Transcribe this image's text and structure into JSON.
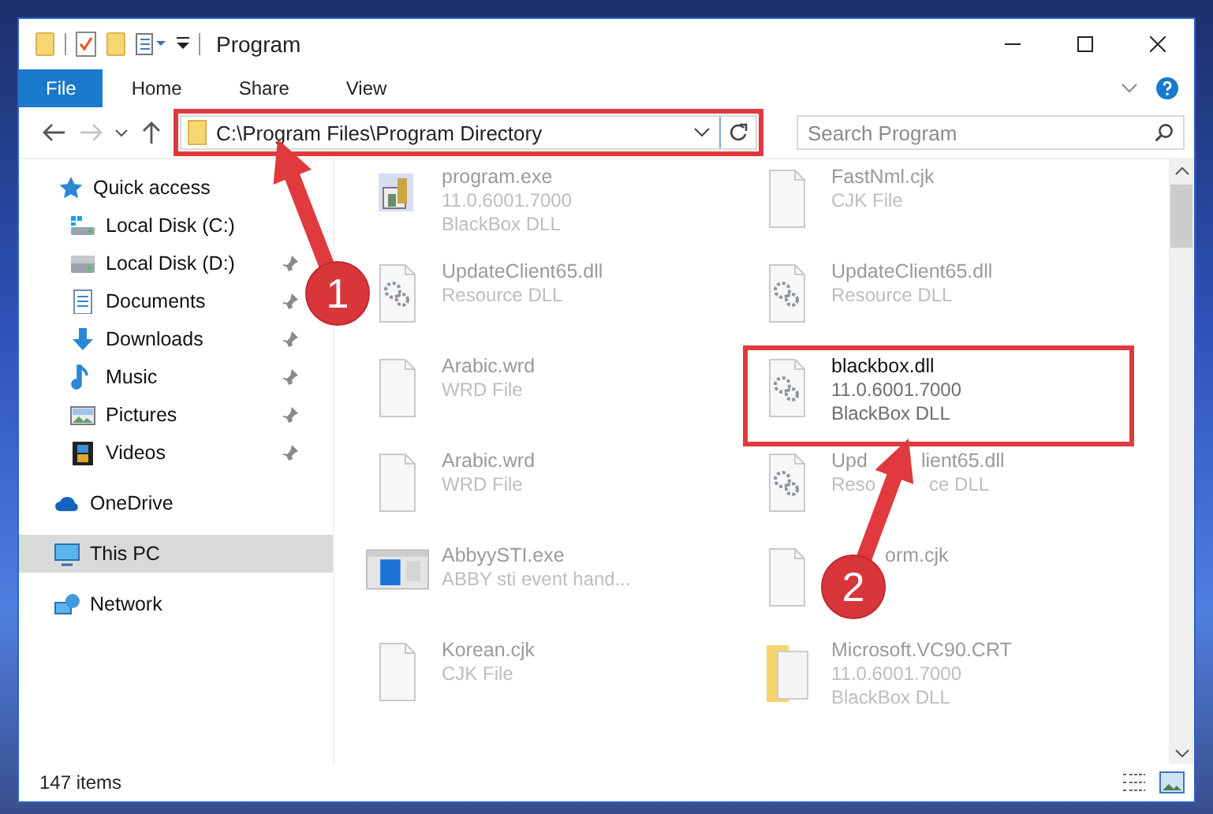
{
  "window": {
    "title": "Program"
  },
  "ribbon_tabs": [
    {
      "label": "File",
      "selected": true
    },
    {
      "label": "Home",
      "selected": false
    },
    {
      "label": "Share",
      "selected": false
    },
    {
      "label": "View",
      "selected": false
    }
  ],
  "address_bar": {
    "path": "C:\\Program Files\\Program Directory",
    "highlighted": true
  },
  "search": {
    "placeholder": "Search Program"
  },
  "sidebar": {
    "items": [
      {
        "label": "Quick access",
        "kind": "quick",
        "selected": false,
        "pinned": false,
        "children": [
          {
            "label": "Local Disk (C:)",
            "kind": "diskc",
            "selected": false,
            "pinned": false
          },
          {
            "label": "Local Disk (D:)",
            "kind": "disk",
            "selected": false,
            "pinned": true
          },
          {
            "label": "Documents",
            "kind": "docs",
            "selected": false,
            "pinned": true
          },
          {
            "label": "Downloads",
            "kind": "down",
            "selected": false,
            "pinned": true
          },
          {
            "label": "Music",
            "kind": "music",
            "selected": false,
            "pinned": true
          },
          {
            "label": "Pictures",
            "kind": "pics",
            "selected": false,
            "pinned": true
          },
          {
            "label": "Videos",
            "kind": "video",
            "selected": false,
            "pinned": true
          }
        ]
      },
      {
        "label": "OneDrive",
        "kind": "cloud",
        "selected": false,
        "pinned": false
      },
      {
        "label": "This PC",
        "kind": "pc",
        "selected": true,
        "pinned": false
      },
      {
        "label": "Network",
        "kind": "net",
        "selected": false,
        "pinned": false
      }
    ]
  },
  "files": [
    {
      "name": "program.exe",
      "details": [
        "11.0.6001.7000",
        "BlackBox DLL"
      ],
      "kind": "exe",
      "highlighted": false
    },
    {
      "name": "FastNml.cjk",
      "details": [
        "CJK File"
      ],
      "kind": "file",
      "highlighted": false
    },
    {
      "name": "UpdateClient65.dll",
      "details": [
        "Resource DLL"
      ],
      "kind": "gear",
      "highlighted": false
    },
    {
      "name": "UpdateClient65.dll",
      "details": [
        "Resource DLL"
      ],
      "kind": "gear",
      "highlighted": false
    },
    {
      "name": "Arabic.wrd",
      "details": [
        "WRD File"
      ],
      "kind": "file",
      "highlighted": false
    },
    {
      "name": "blackbox.dll",
      "details": [
        "11.0.6001.7000",
        "BlackBox DLL"
      ],
      "kind": "gear",
      "highlighted": true
    },
    {
      "name": "Arabic.wrd",
      "details": [
        "WRD File"
      ],
      "kind": "file",
      "highlighted": false
    },
    {
      "name_parts": [
        "Upd",
        "lient65.dll"
      ],
      "detail_parts": [
        "Reso",
        "ce DLL"
      ],
      "gap_first": false,
      "kind": "gear",
      "highlighted": false
    },
    {
      "name": "AbbyySTI.exe",
      "details": [
        "ABBY sti event hand..."
      ],
      "kind": "app",
      "highlighted": false
    },
    {
      "name_parts": [
        "orm.cjk"
      ],
      "gap_first": true,
      "kind": "file",
      "highlighted": false
    },
    {
      "name": "Korean.cjk",
      "details": [
        "CJK File"
      ],
      "kind": "file",
      "highlighted": false
    },
    {
      "name": "Microsoft.VC90.CRT",
      "details": [
        "11.0.6001.7000",
        "BlackBox DLL"
      ],
      "kind": "folder",
      "highlighted": false
    }
  ],
  "annotations": [
    {
      "label": "1"
    },
    {
      "label": "2"
    }
  ],
  "status_bar": {
    "count": "147 items"
  }
}
